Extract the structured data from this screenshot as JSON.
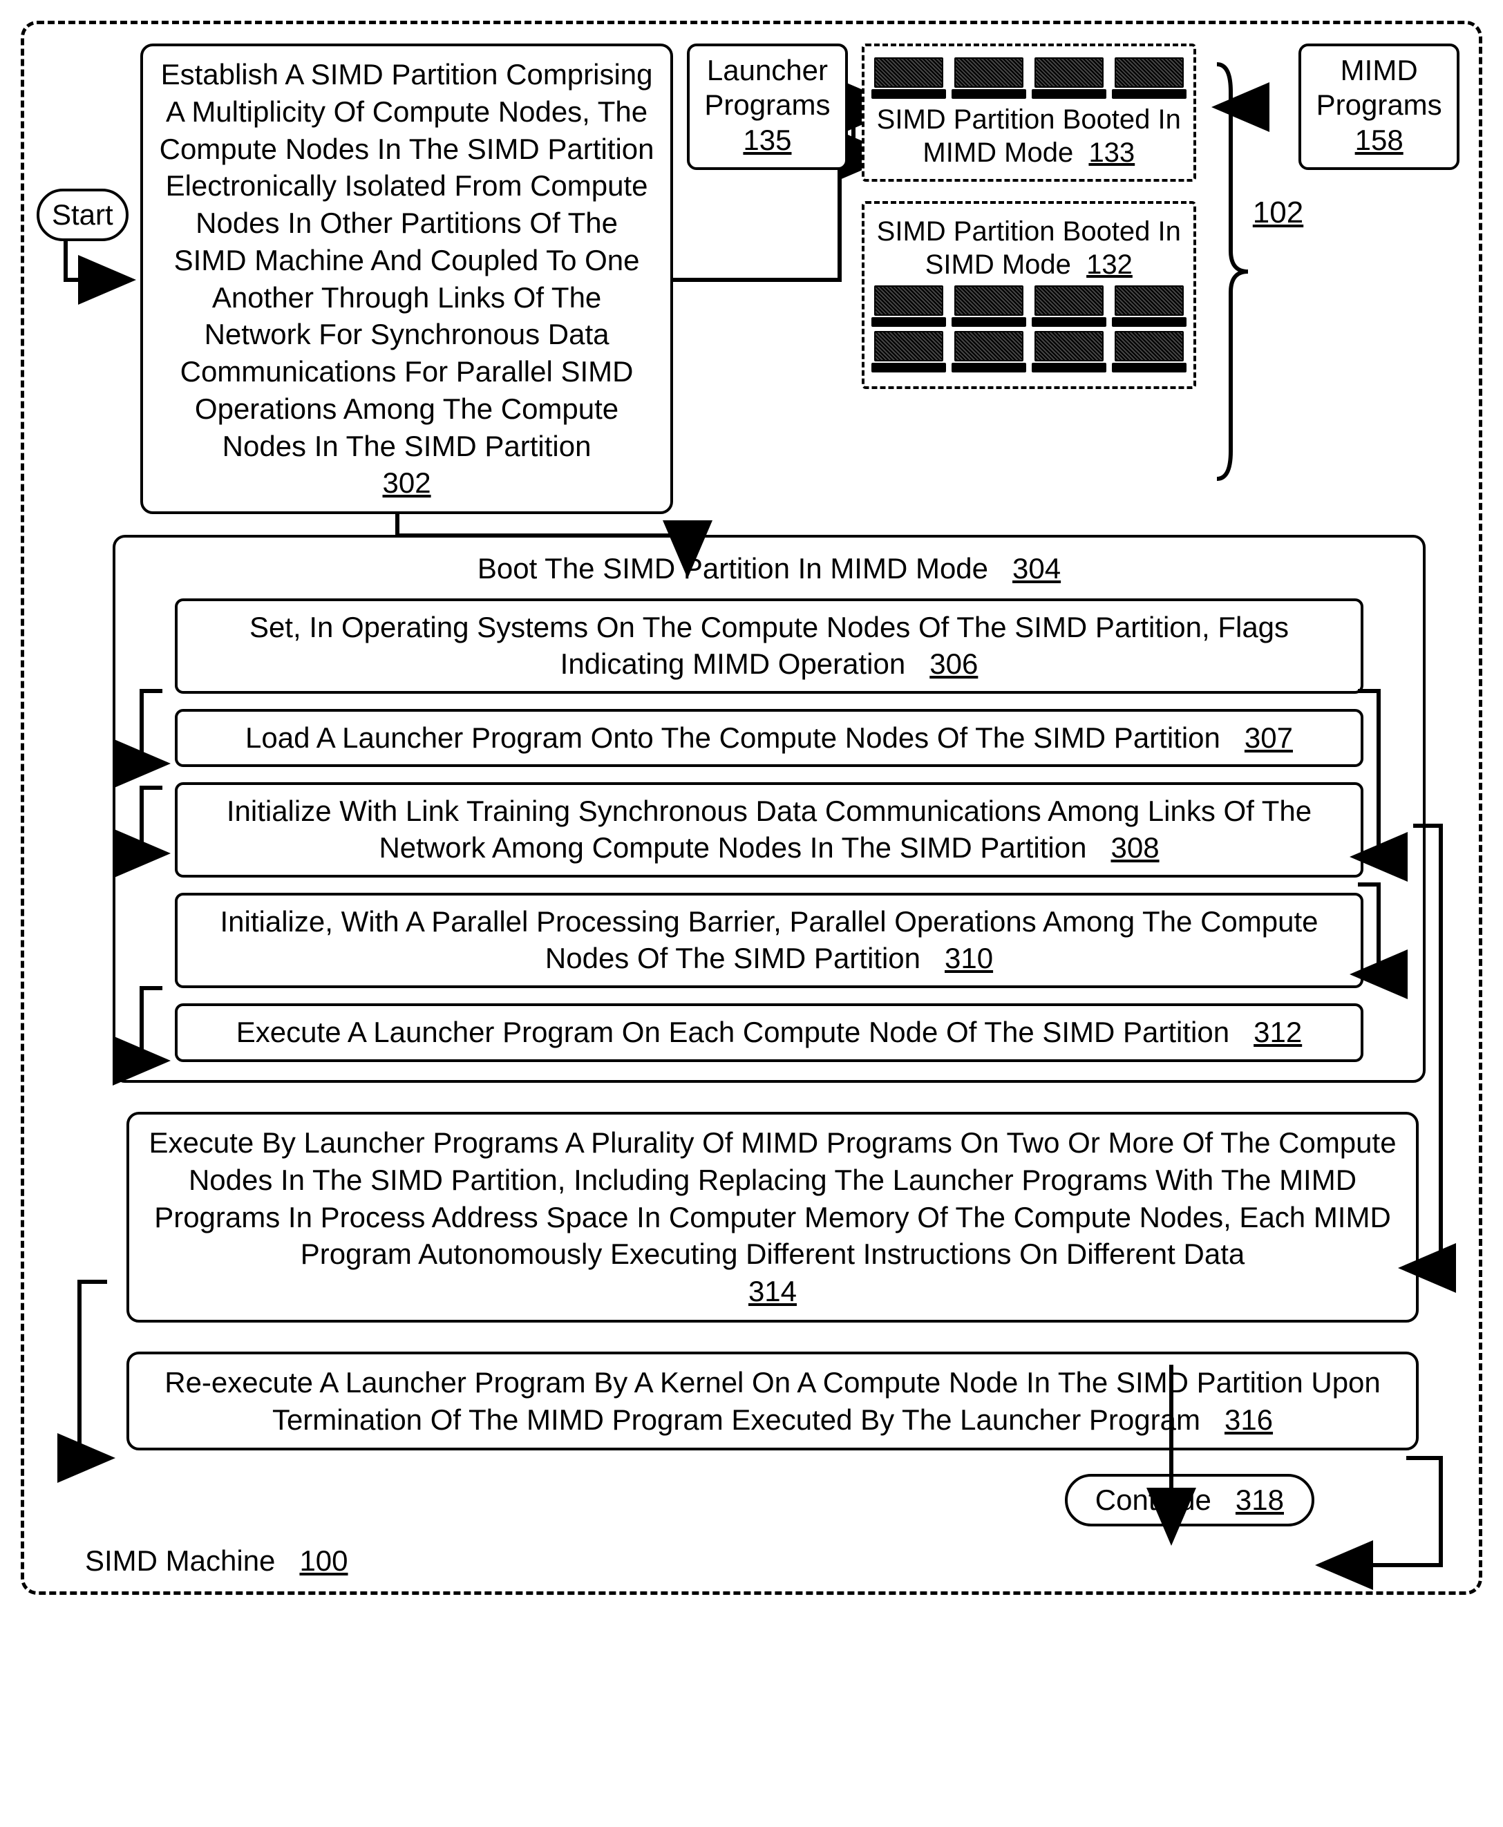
{
  "start": "Start",
  "box302": {
    "text": "Establish A SIMD Partition Comprising A Multiplicity Of Compute Nodes, The Compute Nodes In The SIMD Partition Electronically Isolated From Compute Nodes In Other Partitions Of The SIMD Machine And Coupled To One Another Through Links Of The Network For Synchronous Data Communications For Parallel SIMD Operations Among The Compute Nodes In The SIMD Partition",
    "ref": "302"
  },
  "launcher": {
    "label": "Launcher Programs",
    "ref": "135"
  },
  "mimd": {
    "label": "MIMD Programs",
    "ref": "158"
  },
  "partition133": {
    "label": "SIMD Partition Booted In MIMD Mode",
    "ref": "133"
  },
  "partition132": {
    "label": "SIMD Partition Booted In SIMD Mode",
    "ref": "132"
  },
  "braceRef": "102",
  "box304": {
    "title": "Boot The SIMD Partition In MIMD Mode",
    "ref": "304",
    "sub306": "Set, In Operating Systems On The Compute Nodes Of The SIMD Partition, Flags Indicating MIMD Operation",
    "ref306": "306",
    "sub307": "Load A Launcher Program Onto The Compute Nodes Of The SIMD Partition",
    "ref307": "307",
    "sub308": "Initialize With Link Training Synchronous Data Communications Among Links Of The Network Among Compute Nodes In The SIMD Partition",
    "ref308": "308",
    "sub310": "Initialize, With A Parallel Processing Barrier, Parallel Operations Among The Compute Nodes Of The SIMD Partition",
    "ref310": "310",
    "sub312": "Execute A Launcher Program On Each Compute Node Of The SIMD Partition",
    "ref312": "312"
  },
  "box314": {
    "text": "Execute By Launcher Programs A Plurality Of MIMD Programs On Two Or More Of The Compute Nodes In The SIMD Partition, Including Replacing The Launcher Programs With The MIMD Programs In Process Address Space In Computer Memory Of The Compute Nodes, Each MIMD Program Autonomously Executing Different Instructions On Different Data",
    "ref": "314"
  },
  "box316": {
    "text": "Re-execute A Launcher Program By A Kernel On A Compute Node In The SIMD Partition Upon Termination Of The MIMD Program Executed By The Launcher Program",
    "ref": "316"
  },
  "continue": {
    "label": "Continue",
    "ref": "318"
  },
  "machine": {
    "label": "SIMD Machine",
    "ref": "100"
  }
}
